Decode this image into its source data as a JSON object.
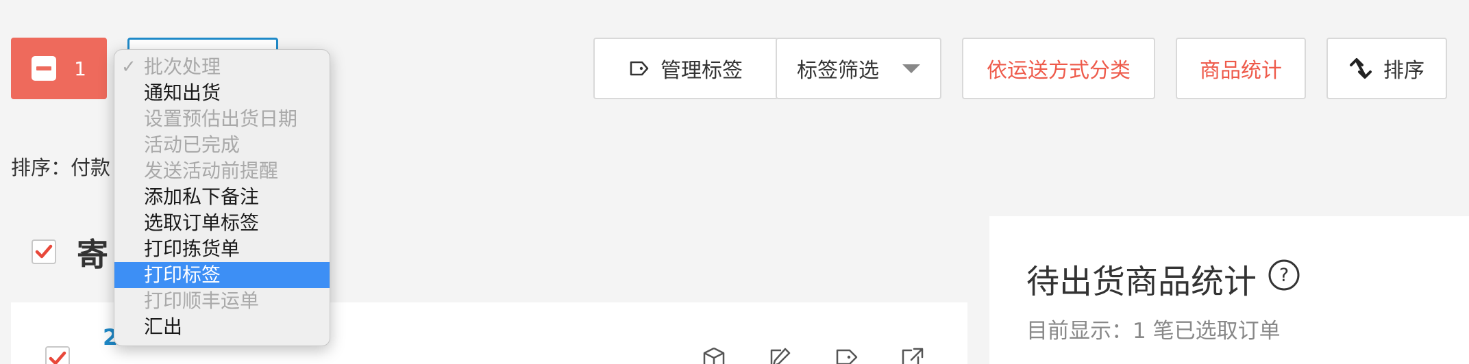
{
  "toolbar": {
    "selected_count": "1",
    "manage_tags": "管理标签",
    "tag_filter": "标签筛选",
    "classify_by_shipping": "依运送方式分类",
    "product_stats": "商品统计",
    "sort": "排序"
  },
  "sort_line": "排序：付款",
  "group": {
    "title_visible": "寄",
    "order_number_visible": "2"
  },
  "batch_menu": {
    "items": [
      {
        "label": "批次处理",
        "state": "disabled-checked"
      },
      {
        "label": "通知出货",
        "state": "enabled"
      },
      {
        "label": "设置预估出货日期",
        "state": "disabled"
      },
      {
        "label": "活动已完成",
        "state": "disabled"
      },
      {
        "label": "发送活动前提醒",
        "state": "disabled"
      },
      {
        "label": "添加私下备注",
        "state": "enabled"
      },
      {
        "label": "选取订单标签",
        "state": "enabled"
      },
      {
        "label": "打印拣货单",
        "state": "enabled"
      },
      {
        "label": "打印标签",
        "state": "highlighted"
      },
      {
        "label": "打印顺丰运单",
        "state": "disabled"
      },
      {
        "label": "汇出",
        "state": "enabled"
      }
    ]
  },
  "stats_panel": {
    "title": "待出货商品统计",
    "subtitle": "目前显示：1 笔已选取订单"
  },
  "colors": {
    "accent_red": "#ee5a4a",
    "selected_blue": "#3d8ff5",
    "link_blue": "#1f8ac9"
  }
}
